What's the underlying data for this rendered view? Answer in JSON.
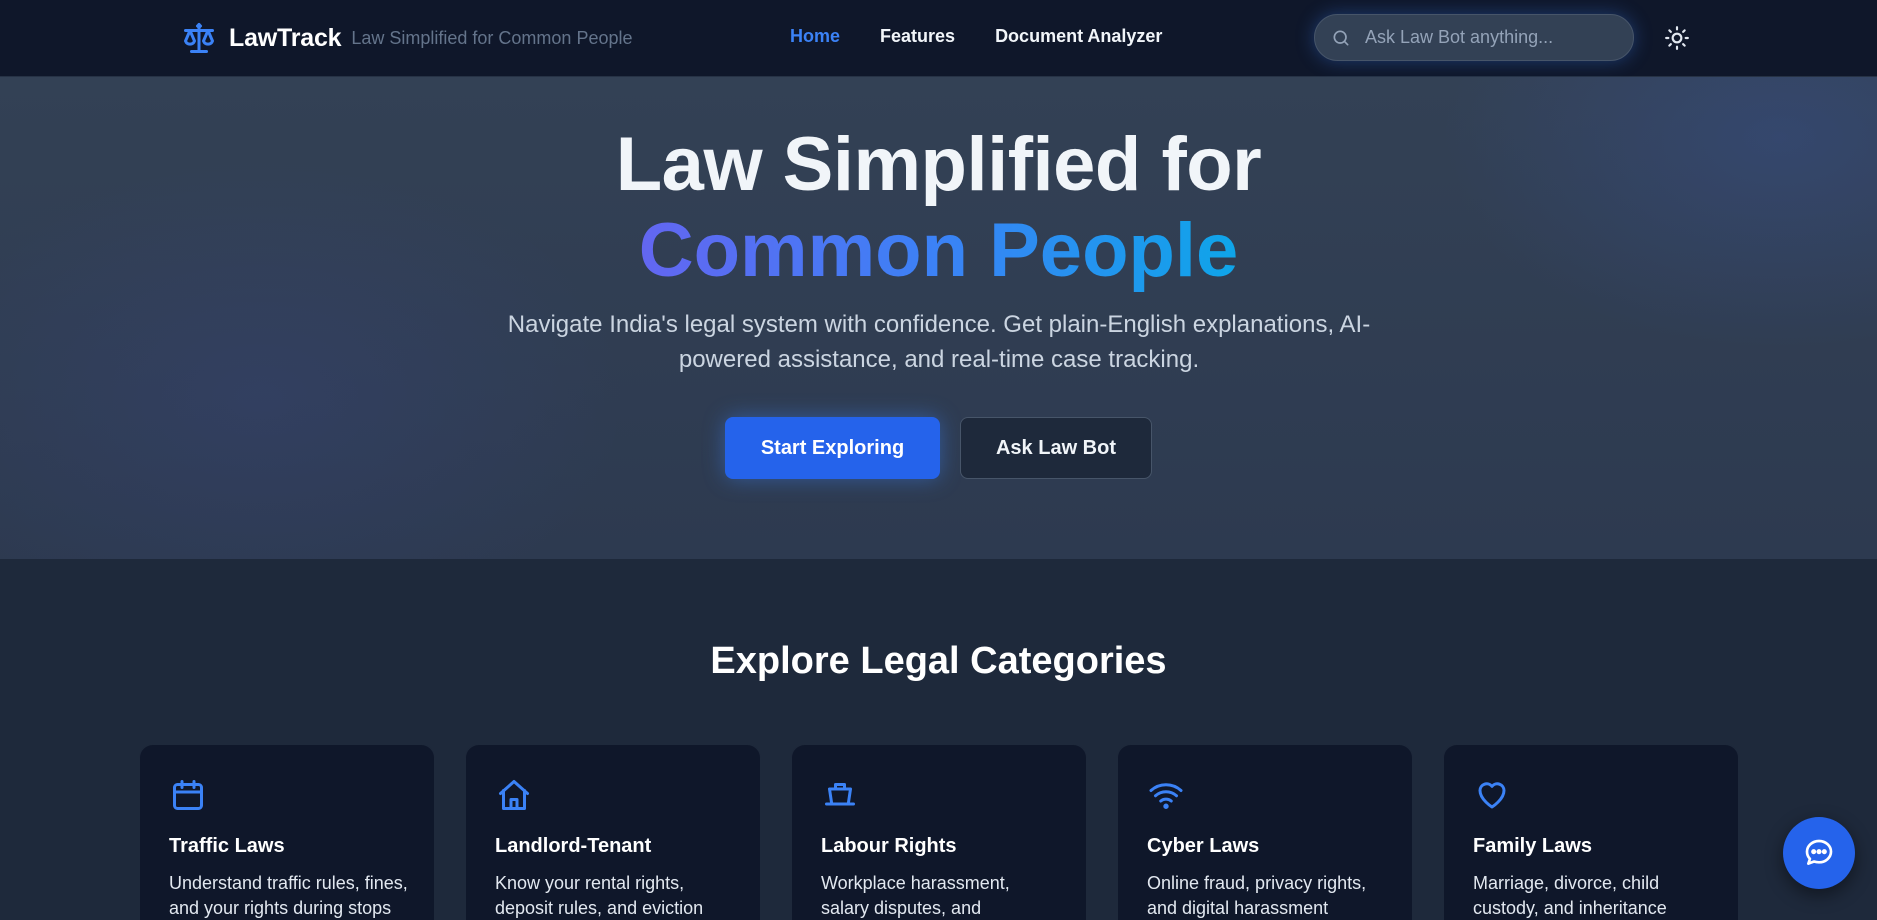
{
  "nav": {
    "brand_name": "LawTrack",
    "brand_tagline": "Law Simplified for Common People",
    "links": [
      "Home",
      "Features",
      "Document Analyzer"
    ],
    "active_link": "Home",
    "search_placeholder": "Ask Law Bot anything...",
    "search_value": ""
  },
  "hero": {
    "title_line1": "Law Simplified for",
    "title_line2": "Common People",
    "subtitle": "Navigate India's legal system with confidence. Get plain-English explanations, AI-powered assistance, and real-time case tracking.",
    "primary_button": "Start Exploring",
    "secondary_button": "Ask Law Bot"
  },
  "categories": {
    "title": "Explore Legal Categories",
    "items": [
      {
        "title": "Traffic Laws",
        "description": "Understand traffic rules, fines, and your rights during stops",
        "icon": "calendar-icon"
      },
      {
        "title": "Landlord-Tenant",
        "description": "Know your rental rights, deposit rules, and eviction",
        "icon": "home-icon"
      },
      {
        "title": "Labour Rights",
        "description": "Workplace harassment, salary disputes, and termination laws",
        "icon": "briefcase-icon"
      },
      {
        "title": "Cyber Laws",
        "description": "Online fraud, privacy rights, and digital harassment",
        "icon": "wifi-icon"
      },
      {
        "title": "Family Laws",
        "description": "Marriage, divorce, child custody, and inheritance",
        "icon": "heart-icon"
      }
    ]
  },
  "colors": {
    "accent": "#3b82f6",
    "primary_button": "#2563eb",
    "nav_background": "#0f172a",
    "page_background": "#1e293b",
    "card_background": "#0f172a"
  }
}
